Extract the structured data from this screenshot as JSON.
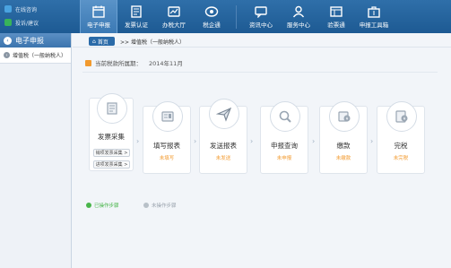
{
  "top_links": [
    {
      "label": "在线咨询",
      "icon": "chat-icon",
      "color": "#4aa3e0"
    },
    {
      "label": "投诉/建议",
      "icon": "feedback-icon",
      "color": "#38b35a"
    }
  ],
  "nav": [
    {
      "label": "电子申报",
      "icon": "calendar-icon",
      "active": true
    },
    {
      "label": "发票认证",
      "icon": "invoice-icon"
    },
    {
      "label": "办税大厅",
      "icon": "hall-icon"
    },
    {
      "label": "税企通",
      "icon": "eye-icon"
    },
    {
      "label": "资讯中心",
      "icon": "message-icon"
    },
    {
      "label": "服务中心",
      "icon": "user-icon"
    },
    {
      "label": "验票通",
      "icon": "ticket-icon"
    },
    {
      "label": "申报工具箱",
      "icon": "toolbox-icon"
    }
  ],
  "sidebar": {
    "title": "电子申报",
    "items": [
      {
        "label": "增值税（一般纳税人）"
      }
    ]
  },
  "breadcrumb": {
    "home": "首页",
    "path": ">> 增值税（一般纳税人）"
  },
  "period": {
    "label": "当前税款所属期：",
    "value": "2014年11月"
  },
  "steps": [
    {
      "title": "发票采集",
      "status": "",
      "icon": "document-icon",
      "buttons": [
        "销项发票采集 >",
        "进项发票采集 >"
      ]
    },
    {
      "title": "填写报表",
      "status": "未填写",
      "icon": "form-icon"
    },
    {
      "title": "发送报表",
      "status": "未发送",
      "icon": "send-icon"
    },
    {
      "title": "申报查询",
      "status": "未申报",
      "icon": "search-icon"
    },
    {
      "title": "缴款",
      "status": "未缴款",
      "icon": "payment-icon"
    },
    {
      "title": "完税",
      "status": "未完税",
      "icon": "tax-done-icon"
    }
  ],
  "legend": [
    {
      "label": "已操作步骤",
      "color": "#49b54b"
    },
    {
      "label": "未操作步骤",
      "color": "#b8c0c8"
    }
  ],
  "colors": {
    "accent": "#2a6aa8",
    "status": "#f39b30"
  }
}
